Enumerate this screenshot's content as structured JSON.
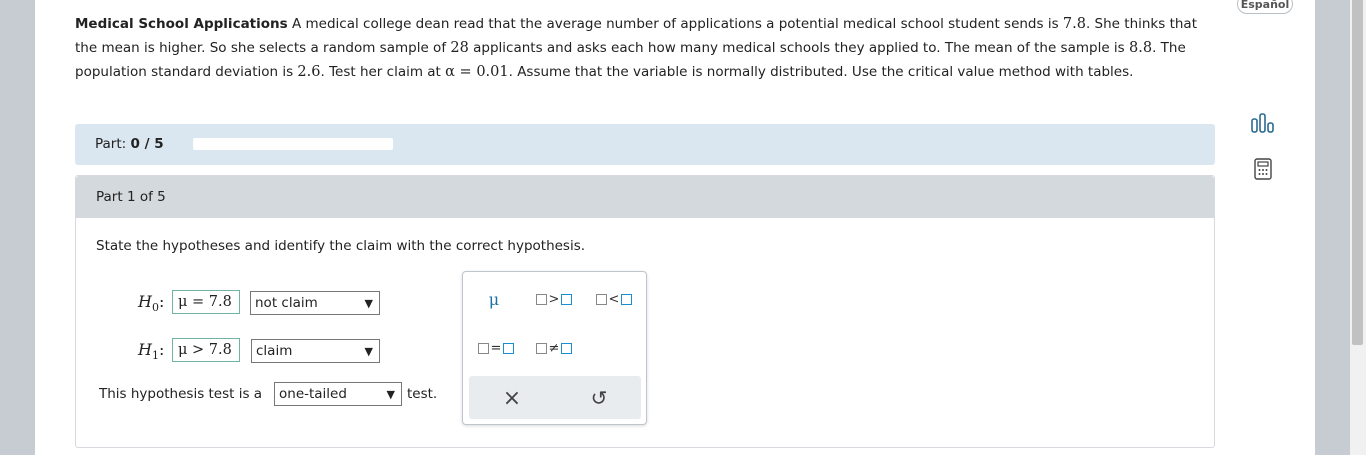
{
  "lang_button": "Español",
  "problem": {
    "title": "Medical School Applications",
    "seg1": " A medical college dean read that the average number of applications a potential medical school student sends is ",
    "val1": "7.8",
    "seg2": ". She thinks that the mean is higher. So she selects a random sample of ",
    "val2": "28",
    "seg3": " applicants and asks each how many medical schools they applied to. The mean of the sample is ",
    "val3": "8.8",
    "seg4": ". The population standard deviation is ",
    "val4": "2.6",
    "seg5": ". Test her claim at ",
    "val5": "α = 0.01",
    "seg6": ". Assume that the variable is normally distributed. Use the critical value method with tables."
  },
  "progress": {
    "label": "Part:",
    "count": "0 / 5",
    "fraction": 0
  },
  "part": {
    "header": "Part 1 of 5",
    "instructions": "State the hypotheses and identify the claim with the correct hypothesis.",
    "h0": {
      "label": "H",
      "sub": "0",
      "colon": ":",
      "answer": "μ = 7.8",
      "select": "not claim"
    },
    "h1": {
      "label": "H",
      "sub": "1",
      "colon": ":",
      "answer": "μ > 7.8",
      "select": "claim"
    },
    "tail_prefix": "This hypothesis test is a",
    "tail_select": "one-tailed",
    "tail_suffix": "test."
  },
  "palette": {
    "mu": "μ",
    "gt": ">",
    "lt": "<",
    "eq": "=",
    "neq": "≠",
    "clear": "×",
    "undo": "↺"
  },
  "colors": {
    "progress": "#4f97d6",
    "answer_border": "#6fb3a5",
    "part_bar": "#dae6f0"
  }
}
